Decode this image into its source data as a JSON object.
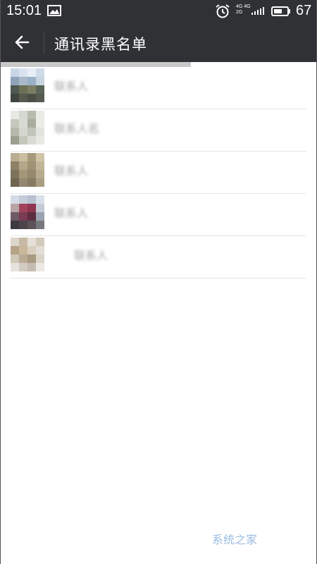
{
  "status_bar": {
    "time": "15:01",
    "network_top": "4G 4G",
    "network_bottom": "2G",
    "battery_percent": "67"
  },
  "app_bar": {
    "title": "通讯录黑名单"
  },
  "contacts": [
    {
      "name": "联系人",
      "avatar_colors": [
        "#c9d6e8",
        "#d9e3ef",
        "#e8eef5",
        "#cfdbe9",
        "#8fa3b8",
        "#a9b9c9",
        "#9ab0c6",
        "#c8d4e0",
        "#4e5a52",
        "#6b6f55",
        "#7d7d66",
        "#5a6458",
        "#3f463f",
        "#555a4e",
        "#4a4f45",
        "#565b50"
      ]
    },
    {
      "name": "联系人名",
      "avatar_colors": [
        "#e7e9e4",
        "#d4d8cf",
        "#b7bcae",
        "#e9ebe6",
        "#c5c9bd",
        "#d8dbd3",
        "#a8ad9f",
        "#ecede9",
        "#b5b8ab",
        "#d3d6cd",
        "#c2c6ba",
        "#e1e3de",
        "#9ca090",
        "#c4c7bc",
        "#d9dbd4",
        "#e8e9e5"
      ]
    },
    {
      "name": "联系人",
      "avatar_colors": [
        "#b9ae92",
        "#c9bd9f",
        "#a79a7c",
        "#d0c4a7",
        "#8e8166",
        "#b4a687",
        "#9f9274",
        "#c1b497",
        "#7d725b",
        "#a39679",
        "#968a6e",
        "#b8ab8e",
        "#6f6550",
        "#948870",
        "#877c63",
        "#aa9e83"
      ]
    },
    {
      "name": "联系人",
      "avatar_colors": [
        "#d5dbe6",
        "#c4ccd9",
        "#b7c1d1",
        "#dbe1ea",
        "#b8a3a6",
        "#a2435b",
        "#8f3550",
        "#c5cbd6",
        "#6e5a62",
        "#7a3c52",
        "#5c2f40",
        "#9aa3b0",
        "#3d3a3f",
        "#4b4448",
        "#5a5257",
        "#77787d"
      ]
    },
    {
      "name": "联系人",
      "avatar_colors": [
        "#dcd6cb",
        "#c7b9a4",
        "#e5e0d8",
        "#d3cabb",
        "#b5a387",
        "#c9b89b",
        "#d8cfbf",
        "#e2ddd5",
        "#cfc7b8",
        "#b9ab93",
        "#a89a80",
        "#dad4c9",
        "#e6e3de",
        "#d2ccc2",
        "#c4bdb0",
        "#ebe8e4"
      ]
    }
  ],
  "watermark": "系统之家"
}
